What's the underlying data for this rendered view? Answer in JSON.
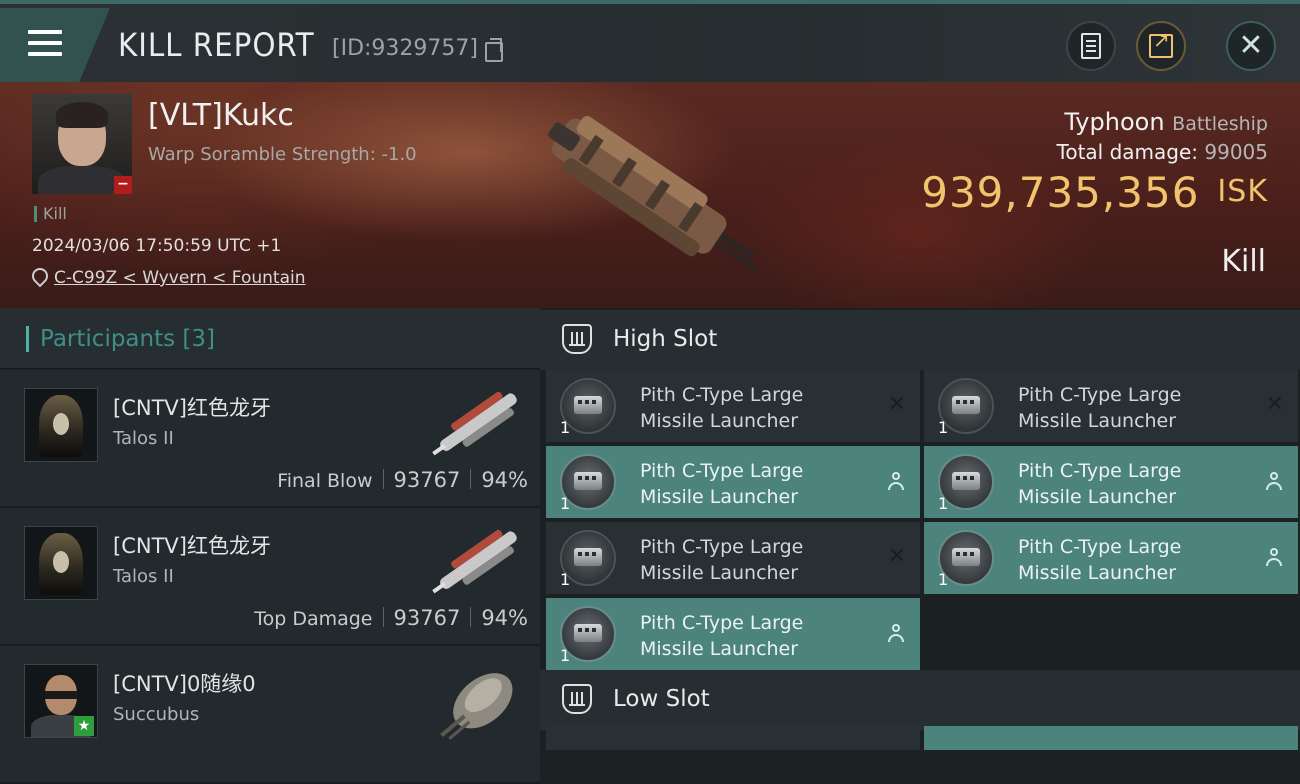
{
  "header": {
    "title": "KILL REPORT",
    "report_id": "[ID:9329757]"
  },
  "victim": {
    "name": "[VLT]Kukc",
    "warp_scramble": "Warp Soramble Strength: -1.0",
    "tag": "Kill",
    "datetime": "2024/03/06 17:50:59 UTC +1",
    "location": "C-C99Z < Wyvern < Fountain",
    "ship_name": "Typhoon",
    "ship_class": "Battleship",
    "total_damage_label": "Total damage:",
    "total_damage": "99005",
    "isk_value": "939,735,356",
    "isk_unit": "ISK",
    "result": "Kill"
  },
  "participants": {
    "label": "Participants",
    "count": "[3]",
    "rows": [
      {
        "name": "[CNTV]红色龙牙",
        "ship": "Talos II",
        "role": "Final Blow",
        "damage": "93767",
        "percent": "94%"
      },
      {
        "name": "[CNTV]红色龙牙",
        "ship": "Talos II",
        "role": "Top Damage",
        "damage": "93767",
        "percent": "94%"
      },
      {
        "name": "[CNTV]0随缘0",
        "ship": "Succubus"
      }
    ]
  },
  "slots": {
    "high_label": "High Slot",
    "low_label": "Low Slot",
    "modules": [
      {
        "line1": "Pith C-Type Large",
        "line2": "Missile Launcher",
        "qty": "1",
        "status": "destroyed"
      },
      {
        "line1": "Pith C-Type Large",
        "line2": "Missile Launcher",
        "qty": "1",
        "status": "destroyed"
      },
      {
        "line1": "Pith C-Type Large",
        "line2": "Missile Launcher",
        "qty": "1",
        "status": "dropped"
      },
      {
        "line1": "Pith C-Type Large",
        "line2": "Missile Launcher",
        "qty": "1",
        "status": "dropped"
      },
      {
        "line1": "Pith C-Type Large",
        "line2": "Missile Launcher",
        "qty": "1",
        "status": "destroyed"
      },
      {
        "line1": "Pith C-Type Large",
        "line2": "Missile Launcher",
        "qty": "1",
        "status": "dropped"
      },
      {
        "line1": "Pith C-Type Large",
        "line2": "Missile Launcher",
        "qty": "1",
        "status": "dropped"
      }
    ]
  },
  "icons": {
    "menu": "menu-icon",
    "copy": "copy-icon",
    "clipboard": "clipboard-icon",
    "share": "share-icon",
    "close": "close-icon",
    "location": "location-pin-icon",
    "destroyed": "x-icon",
    "dropped": "person-icon"
  },
  "colors": {
    "accent_teal": "#4d837d",
    "isk_gold": "#f1c46c",
    "header_teal": "#3f8f88"
  }
}
